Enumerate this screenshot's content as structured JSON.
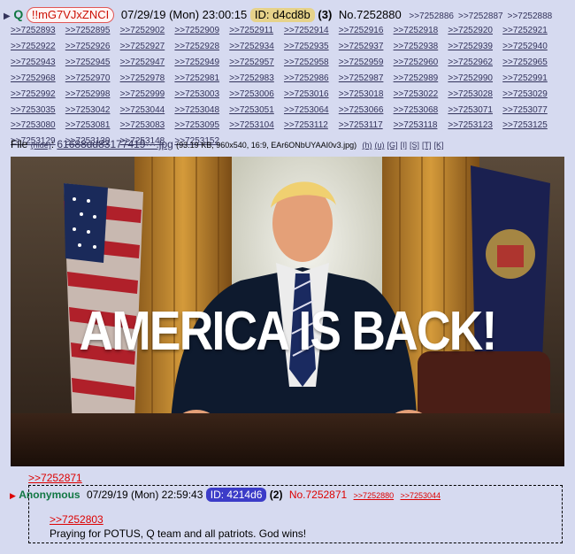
{
  "post": {
    "name": "Q",
    "tripcode": "!!mG7VJxZNCI",
    "datetime": "07/29/19 (Mon) 23:00:15",
    "id_label": "ID: d4cd8b",
    "count": "(3)",
    "number": "No.7252880",
    "backlinks": [
      ">>7252886",
      ">>7252887",
      ">>7252888",
      ">>7252893",
      ">>7252895",
      ">>7252902",
      ">>7252909",
      ">>7252911",
      ">>7252914",
      ">>7252916",
      ">>7252918",
      ">>7252920",
      ">>7252921",
      ">>7252922",
      ">>7252926",
      ">>7252927",
      ">>7252928",
      ">>7252934",
      ">>7252935",
      ">>7252937",
      ">>7252938",
      ">>7252939",
      ">>7252940",
      ">>7252943",
      ">>7252945",
      ">>7252947",
      ">>7252949",
      ">>7252957",
      ">>7252958",
      ">>7252959",
      ">>7252960",
      ">>7252962",
      ">>7252965",
      ">>7252968",
      ">>7252970",
      ">>7252978",
      ">>7252981",
      ">>7252983",
      ">>7252986",
      ">>7252987",
      ">>7252989",
      ">>7252990",
      ">>7252991",
      ">>7252992",
      ">>7252998",
      ">>7252999",
      ">>7253003",
      ">>7253006",
      ">>7253016",
      ">>7253018",
      ">>7253022",
      ">>7253028",
      ">>7253029",
      ">>7253035",
      ">>7253042",
      ">>7253044",
      ">>7253048",
      ">>7253051",
      ">>7253064",
      ">>7253066",
      ">>7253068",
      ">>7253071",
      ">>7253077",
      ">>7253080",
      ">>7253081",
      ">>7253083",
      ">>7253095",
      ">>7253104",
      ">>7253112",
      ">>7253117",
      ">>7253118",
      ">>7253123",
      ">>7253125",
      ">>7253129",
      ">>7253139",
      ">>7253148",
      ">>7253152"
    ],
    "file": {
      "label": "File",
      "hide": "(hide)",
      "name": "61688dd83177419···.jpg",
      "meta": "(93.19 KB, 960x540, 16:9, EAr6ONbUYAAI0v3.jpg)",
      "links": [
        "(h)",
        "(u)",
        "[G]",
        "[I]",
        "[S]",
        "[T]",
        "[K]"
      ]
    },
    "image_caption": "AMERICA IS BACK!",
    "quote": ">>7252871"
  },
  "reply": {
    "name": "Anonymous",
    "datetime": "07/29/19 (Mon) 22:59:43",
    "id_label": "ID: 4214d6",
    "count": "(2)",
    "number": "No.7252871",
    "backlinks": [
      ">>7252880",
      ">>7253044"
    ],
    "quote": ">>7252803",
    "text": "Praying for POTUS, Q team and all patriots. God wins!"
  },
  "colors": {
    "background": "#d6daf0",
    "link": "#34345c",
    "name_green": "#117743",
    "quote_red": "#dd0000",
    "id_tan": "#e6d28a",
    "id_blue": "#3c3cc8"
  }
}
